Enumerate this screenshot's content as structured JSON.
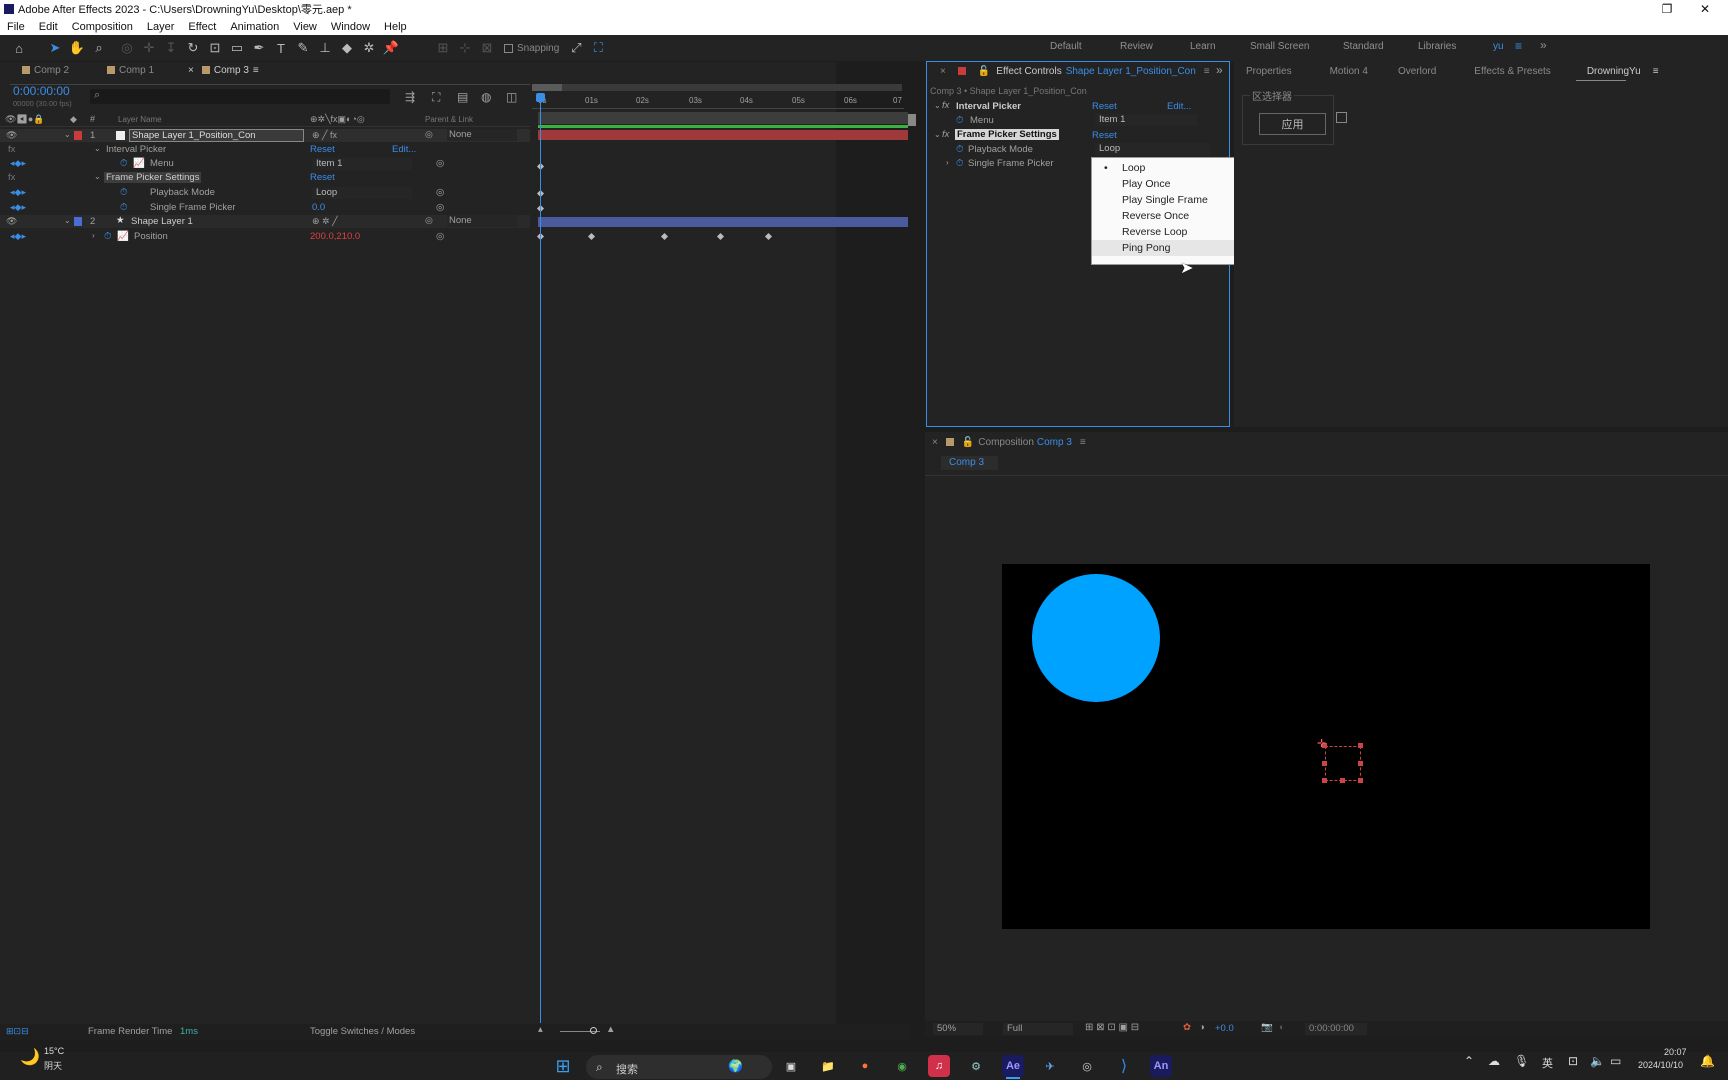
{
  "window": {
    "title": "Adobe After Effects 2023 - C:\\Users\\DrowningYu\\Desktop\\零元.aep *"
  },
  "menu": [
    "File",
    "Edit",
    "Composition",
    "Layer",
    "Effect",
    "Animation",
    "View",
    "Window",
    "Help"
  ],
  "toolbar": {
    "snapping_label": "Snapping"
  },
  "workspaces": [
    "Default",
    "Review",
    "Learn",
    "Small Screen",
    "Standard",
    "Libraries",
    "yu"
  ],
  "project_tabs": [
    {
      "label": "Comp 2",
      "color": "#b89a6a"
    },
    {
      "label": "Comp 1",
      "color": "#b89a6a"
    },
    {
      "label": "Comp 3",
      "color": "#b89a6a",
      "active": true
    }
  ],
  "timeline": {
    "timecode": "0:00:00:00",
    "timecode_sub": "00000 (30.00 fps)",
    "search_placeholder": "",
    "col_layer_name": "Layer Name",
    "col_parent": "Parent & Link",
    "ruler": [
      "0s",
      "01s",
      "02s",
      "03s",
      "04s",
      "05s",
      "06s",
      "07"
    ],
    "layers": [
      {
        "num": "1",
        "name": "Shape Layer 1_Position_Con",
        "color": "#c83c3c",
        "parent": "None"
      },
      {
        "num": "2",
        "name": "Shape Layer 1",
        "color": "#4a6cd4",
        "parent": "None"
      }
    ],
    "effects": {
      "interval_picker": "Interval Picker",
      "reset": "Reset",
      "edit": "Edit...",
      "menu_label": "Menu",
      "menu_value": "Item 1",
      "frame_picker": "Frame Picker Settings",
      "playback_mode": "Playback Mode",
      "playback_value": "Loop",
      "single_frame": "Single Frame Picker",
      "single_frame_value": "0.0",
      "position": "Position",
      "position_value": "200.0,210.0"
    },
    "footer": {
      "render_label": "Frame Render Time",
      "render_value": "1ms",
      "toggle": "Toggle Switches / Modes"
    }
  },
  "effect_controls": {
    "tab": "Effect Controls",
    "tab_layer": "Shape Layer 1_Position_Con",
    "breadcrumb": "Comp 3 • Shape Layer 1_Position_Con",
    "interval_picker": "Interval Picker",
    "reset": "Reset",
    "edit": "Edit...",
    "menu_label": "Menu",
    "menu_value": "Item 1",
    "frame_picker": "Frame Picker Settings",
    "playback_mode": "Playback Mode",
    "playback_value": "Loop",
    "single_frame": "Single Frame Picker"
  },
  "dropdown": {
    "items": [
      "Loop",
      "Play Once",
      "Play Single Frame",
      "Reverse Once",
      "Reverse Loop",
      "Ping Pong"
    ],
    "selected": "Loop",
    "hovered": "Ping Pong"
  },
  "right_panels": {
    "tabs": [
      "Properties",
      "Motion 4",
      "Overlord",
      "Effects & Presets",
      "DrowningYu"
    ],
    "group_label": "区选择器",
    "apply_button": "应用"
  },
  "composition": {
    "tab_label": "Composition",
    "tab_comp": "Comp 3",
    "sub_tab": "Comp 3",
    "zoom": "50%",
    "resolution": "Full",
    "exposure": "+0.0",
    "timecode": "0:00:00:00",
    "circle_color": "#00a2ff"
  },
  "taskbar": {
    "weather_temp": "15°C",
    "weather_desc": "阴天",
    "search_label": "搜索",
    "lang": "英",
    "time": "20:07",
    "date": "2024/10/10"
  }
}
